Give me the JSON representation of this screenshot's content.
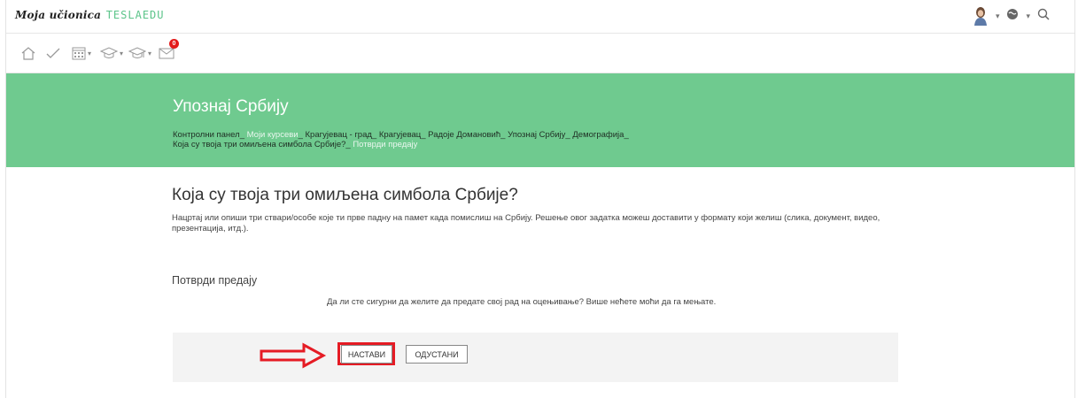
{
  "header": {
    "logo_script": "Moja učionica",
    "logo_brand": "TESLAEDU"
  },
  "toolbar": {
    "items": [
      "home-icon",
      "check-icon",
      "calendar-icon",
      "courses-icon",
      "graduation-icon",
      "messages-icon"
    ],
    "messages_badge": "0"
  },
  "hero": {
    "title": "Упознај Србију",
    "breadcrumb": [
      "Контролни панел",
      "Моји курсеви",
      "Крагујевац - град",
      "Крагујевац",
      "Радоје Домановић",
      "Упознај Србију",
      "Демографија",
      "Која су твоја три омиљена симбола Србије?",
      "Потврди предају"
    ]
  },
  "assignment": {
    "title": "Која су твоја три омиљена симбола Србије?",
    "description": "Нацртај или опиши три ствари/особе које ти прве падну на памет када помислиш на Србију. Решење овог задатка можеш доставити у формату који желиш (слика, документ, видео, презентација, итд.)."
  },
  "confirm": {
    "heading": "Потврди предају",
    "message": "Да ли сте сигурни да желите да предате свој рад на оцењивање? Више нећете моћи да га мењате.",
    "continue_label": "НАСТАВИ",
    "cancel_label": "ОДУСТАНИ"
  },
  "colors": {
    "hero_bg": "#6fca8f",
    "highlight": "#e51b24",
    "brand_green": "#5cc48a"
  }
}
